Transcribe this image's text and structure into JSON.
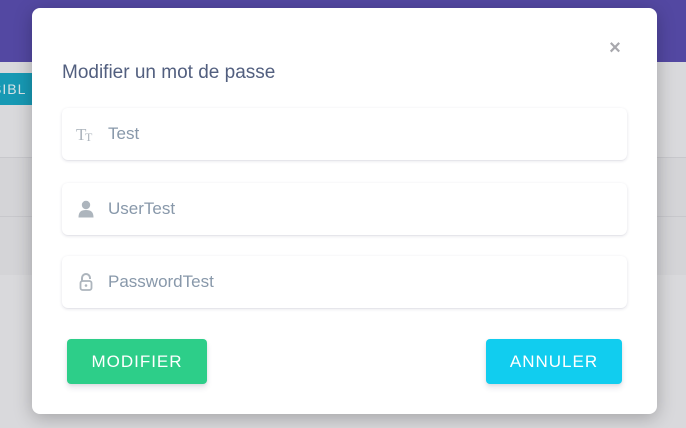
{
  "background": {
    "partial_button_text": "SIBL"
  },
  "modal": {
    "title": "Modifier un mot de passe",
    "close_label": "×",
    "fields": [
      {
        "icon": "text-height-icon",
        "value": "Test"
      },
      {
        "icon": "user-icon",
        "value": "UserTest"
      },
      {
        "icon": "unlock-icon",
        "value": "PasswordTest"
      }
    ],
    "buttons": {
      "modifier_label": "MODIFIER",
      "annuler_label": "ANNULER"
    }
  },
  "colors": {
    "header": "#5b4fb0",
    "modifier": "#2dce89",
    "annuler": "#11cdef",
    "title": "#525f7f"
  }
}
